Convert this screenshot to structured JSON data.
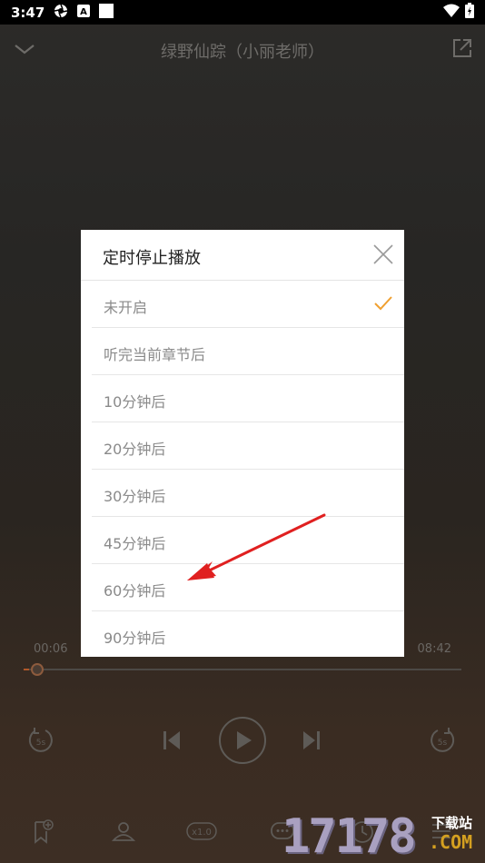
{
  "status_bar": {
    "time": "3:47",
    "icons_left": [
      "aperture-icon",
      "a-badge-icon",
      "square-icon"
    ],
    "icons_right": [
      "wifi-icon",
      "battery-charging-icon"
    ]
  },
  "top_bar": {
    "title": "绿野仙踪（小丽老师）",
    "left_icon": "chevron-down-icon",
    "right_icon": "share-external-icon"
  },
  "player": {
    "current_time": "00:06",
    "total_time": "08:42",
    "progress_fraction": 0.012,
    "controls": [
      "rewind-5s-icon",
      "previous-icon",
      "play-icon",
      "next-icon",
      "forward-5s-icon"
    ],
    "speed_label": "x1.0",
    "bottom_icons": [
      "bookmark-add-icon",
      "anchor-user-icon",
      "speed-icon",
      "comment-icon",
      "timer-icon",
      "playlist-icon"
    ]
  },
  "timer_dialog": {
    "title": "定时停止播放",
    "close_icon": "close-icon",
    "options": [
      {
        "label": "未开启",
        "selected": true
      },
      {
        "label": "听完当前章节后",
        "selected": false
      },
      {
        "label": "10分钟后",
        "selected": false
      },
      {
        "label": "20分钟后",
        "selected": false
      },
      {
        "label": "30分钟后",
        "selected": false
      },
      {
        "label": "45分钟后",
        "selected": false
      },
      {
        "label": "60分钟后",
        "selected": false
      },
      {
        "label": "90分钟后",
        "selected": false
      }
    ]
  },
  "colors": {
    "accent_check": "#f0a030",
    "arrow_red": "#e02020",
    "dialog_bg": "#ffffff"
  },
  "watermark": {
    "digits": "17178",
    "site_cn": "下载站",
    "site_com": ".COM"
  }
}
